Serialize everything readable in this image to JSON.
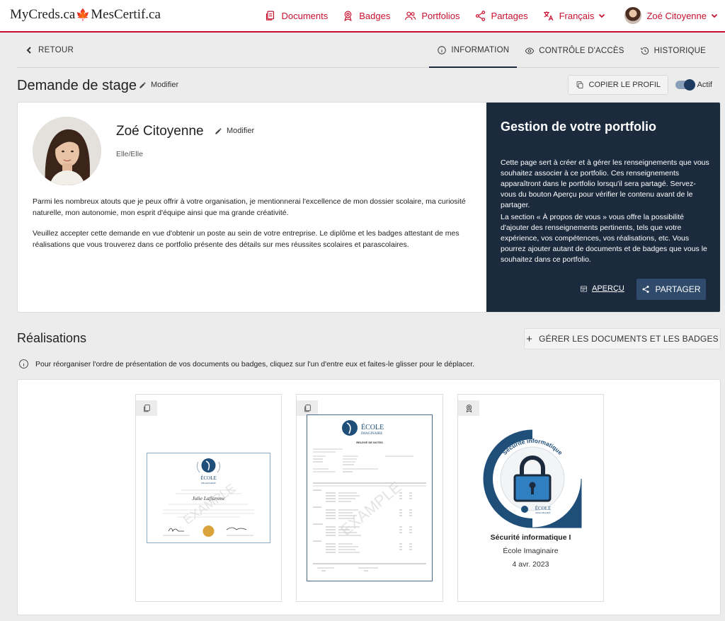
{
  "brand": {
    "name_left": "MyCreds.ca",
    "leaf": "🍁",
    "name_right": "MesCertif.ca"
  },
  "nav": {
    "documents": "Documents",
    "badges": "Badges",
    "portfolios": "Portfolios",
    "shares": "Partages",
    "language": "Français",
    "user": "Zoé Citoyenne"
  },
  "subbar": {
    "back": "RETOUR",
    "tabs": [
      "INFORMATION",
      "CONTRÔLE D'ACCÈS",
      "HISTORIQUE"
    ]
  },
  "portfolio": {
    "title": "Demande de stage",
    "edit": "Modifier",
    "copy_profile": "COPIER LE PROFIL",
    "active_label": "Actif"
  },
  "profile": {
    "name": "Zoé Citoyenne",
    "edit": "Modifier",
    "pronouns": "Elle/Elle",
    "bio": [
      "Parmi les nombreux atouts que je peux offrir à votre organisation, je mentionnerai l'excellence de mon dossier scolaire, ma curiosité naturelle, mon autonomie, mon esprit d'équipe ainsi que ma grande créativité.",
      "Veuillez accepter cette demande en vue d'obtenir un poste au sein de votre entreprise. Le diplôme et les badges attestant de mes réalisations que vous trouverez dans ce portfolio présente des détails sur mes réussites scolaires et parascolaires."
    ]
  },
  "panel": {
    "title": "Gestion de votre portfolio",
    "p1": "Cette page sert à créer et à gérer les renseignements que vous souhaitez associer à ce portfolio. Ces renseignements apparaîtront dans le portfolio lorsqu'il sera partagé. Servez-vous du bouton Aperçu pour vérifier le contenu avant de le partager.",
    "p2": "La section « À propos de vous » vous offre la possibilité d'ajouter des renseignements pertinents, tels que votre expérience, vos compétences, vos réalisations, etc. Vous pourrez ajouter autant de documents et de badges que vous le souhaitez dans ce portfolio.",
    "preview": "APERÇU",
    "share": "PARTAGER"
  },
  "achievements": {
    "title": "Réalisations",
    "manage": "GÉRER LES DOCUMENTS ET LES BADGES",
    "hint": "Pour réorganiser l'ordre de présentation de vos documents ou badges, cliquez sur l'un d'entre eux et faites-le glisser pour le déplacer.",
    "badge": {
      "title": "Sécurité informatique I",
      "issuer": "École Imaginaire",
      "date": "4 avr. 2023",
      "ring_text": "Sécurité informatique",
      "school": "ÉCOLE",
      "school_sub": "IMAGINAIRE"
    },
    "diploma": {
      "school": "ÉCOLE",
      "school_sub": "IMAGINAIRE",
      "recipient": "Julie Laflamme",
      "watermark": "EXAMPLE"
    },
    "transcript": {
      "school": "ÉCOLE",
      "school_sub": "IMAGINAIRE",
      "heading": "RELEVÉ DE NOTES",
      "watermark": "EXAMPLE"
    }
  },
  "colors": {
    "brand_red": "#c8102e",
    "navy": "#1b2a3d",
    "button_navy": "#2f4a6b",
    "badge_blue": "#1f4e79"
  }
}
